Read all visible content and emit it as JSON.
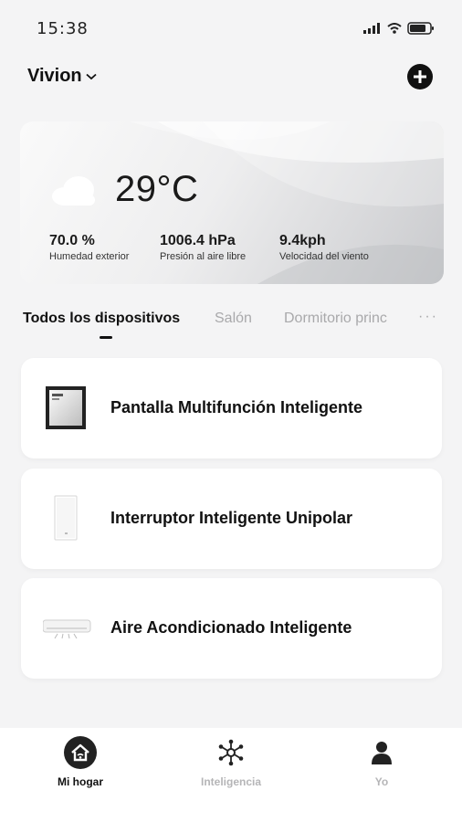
{
  "status_bar": {
    "time": "15:38"
  },
  "header": {
    "home_name": "Vivion"
  },
  "weather": {
    "temperature": "29°C",
    "stats": [
      {
        "value": "70.0 %",
        "label": "Humedad exterior"
      },
      {
        "value": "1006.4 hPa",
        "label": "Presión al aire libre"
      },
      {
        "value": "9.4kph",
        "label": "Velocidad del viento"
      }
    ]
  },
  "tabs": [
    {
      "label": "Todos los dispositivos",
      "active": true
    },
    {
      "label": "Salón",
      "active": false
    },
    {
      "label": "Dormitorio princ",
      "active": false
    }
  ],
  "tabs_more": "···",
  "devices": [
    {
      "name": "Pantalla Multifunción Inteligente",
      "icon": "multifunction-panel-icon"
    },
    {
      "name": "Interruptor Inteligente Unipolar",
      "icon": "wall-switch-icon"
    },
    {
      "name": "Aire Acondicionado Inteligente",
      "icon": "air-conditioner-icon"
    }
  ],
  "bottom_nav": [
    {
      "label": "Mi hogar",
      "icon": "home-icon",
      "active": true
    },
    {
      "label": "Inteligencia",
      "icon": "network-icon",
      "active": false
    },
    {
      "label": "Yo",
      "icon": "person-icon",
      "active": false
    }
  ]
}
